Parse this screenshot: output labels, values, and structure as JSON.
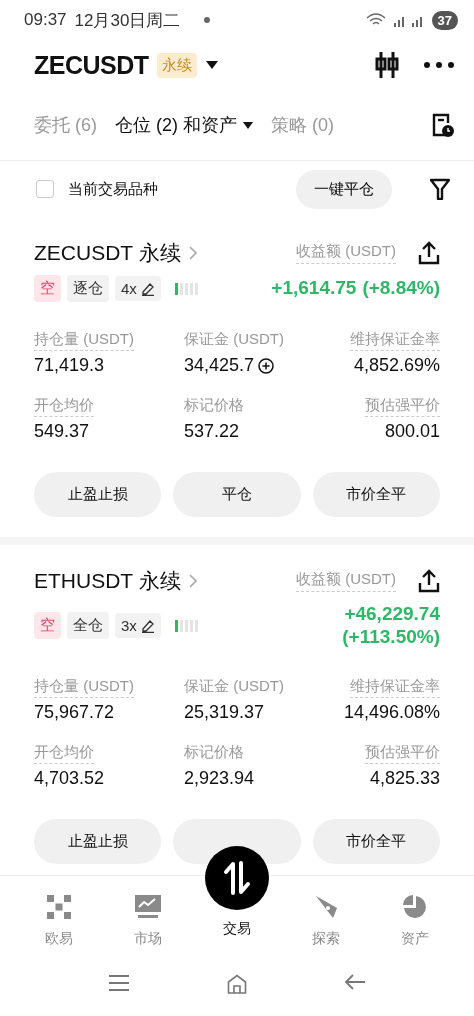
{
  "status_bar": {
    "time": "09:37",
    "date": "12月30日周二",
    "battery": "37"
  },
  "header": {
    "symbol": "ZECUSDT",
    "badge": "永续"
  },
  "tabs": [
    {
      "label": "委托 (6)",
      "selected": false,
      "dropdown": false
    },
    {
      "label": "仓位 (2) 和资产",
      "selected": true,
      "dropdown": true
    },
    {
      "label": "策略 (0)",
      "selected": false,
      "dropdown": false
    }
  ],
  "filter": {
    "label": "当前交易品种",
    "checked": false,
    "close_all": "一键平仓"
  },
  "positions": [
    {
      "title": "ZECUSDT 永续",
      "pnl_label": "收益额 (USDT)",
      "side": "空",
      "margin_mode": "逐仓",
      "leverage": "4x",
      "level": 0.2,
      "pnl": "+1,614.75",
      "pnl_pct": "(+8.84%)",
      "stats": [
        {
          "label": "持仓量 (USDT)",
          "value": "71,419.3",
          "underlined": true,
          "add": false
        },
        {
          "label": "保证金 (USDT)",
          "value": "34,425.7",
          "underlined": false,
          "add": true
        },
        {
          "label": "维持保证金率",
          "value": "4,852.69%",
          "underlined": true,
          "add": false
        },
        {
          "label": "开仓均价",
          "value": "549.37",
          "underlined": true,
          "add": false
        },
        {
          "label": "标记价格",
          "value": "537.22",
          "underlined": false,
          "add": false
        },
        {
          "label": "预估强平价",
          "value": "800.01",
          "underlined": true,
          "add": false
        }
      ],
      "buttons": [
        {
          "label": "止盈止损",
          "kind": "text"
        },
        {
          "label": "平仓",
          "kind": "text"
        },
        {
          "label": "市价全平",
          "kind": "text"
        }
      ]
    },
    {
      "title": "ETHUSDT 永续",
      "pnl_label": "收益额 (USDT)",
      "side": "空",
      "margin_mode": "全仓",
      "leverage": "3x",
      "level": 0.2,
      "pnl": "+46,229.74",
      "pnl_pct": "(+113.50%)",
      "stats": [
        {
          "label": "持仓量 (USDT)",
          "value": "75,967.72",
          "underlined": true,
          "add": false
        },
        {
          "label": "保证金 (USDT)",
          "value": "25,319.37",
          "underlined": false,
          "add": false
        },
        {
          "label": "维持保证金率",
          "value": "14,496.08%",
          "underlined": true,
          "add": false
        },
        {
          "label": "开仓均价",
          "value": "4,703.52",
          "underlined": true,
          "add": false
        },
        {
          "label": "标记价格",
          "value": "2,923.94",
          "underlined": false,
          "add": false
        },
        {
          "label": "预估强平价",
          "value": "4,825.33",
          "underlined": true,
          "add": false
        }
      ],
      "buttons": [
        {
          "label": "止盈止损",
          "kind": "text"
        },
        {
          "kind": "blank"
        },
        {
          "label": "市价全平",
          "kind": "text"
        }
      ]
    }
  ],
  "nav": [
    {
      "label": "欧易",
      "kind": "grid",
      "selected": false
    },
    {
      "label": "市场",
      "kind": "chart",
      "selected": false
    },
    {
      "label": "交易",
      "kind": "trade",
      "selected": true
    },
    {
      "label": "探索",
      "kind": "compass",
      "selected": false
    },
    {
      "label": "资产",
      "kind": "pie",
      "selected": false
    }
  ]
}
